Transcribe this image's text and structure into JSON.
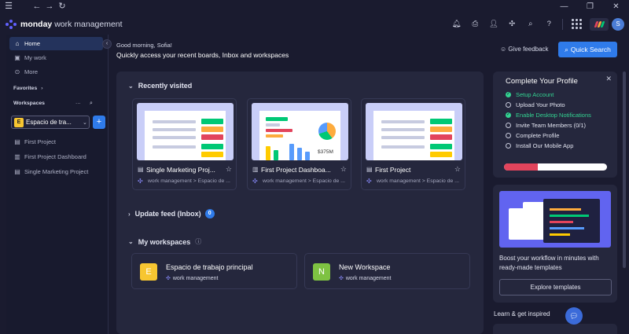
{
  "titlebar": {
    "menu_icon": "hamburger-icon",
    "back_icon": "arrow-left-icon",
    "forward_icon": "arrow-right-icon",
    "reload_icon": "reload-icon"
  },
  "brand": {
    "name": "monday",
    "suffix": "work management"
  },
  "sidebar": {
    "nav": [
      {
        "label": "Home",
        "icon": "home-icon"
      },
      {
        "label": "My work",
        "icon": "calendar-icon"
      },
      {
        "label": "More",
        "icon": "more-icon"
      }
    ],
    "favorites_label": "Favorites",
    "workspaces_label": "Workspaces",
    "workspace_selected": "Espacio de tra...",
    "workspace_initial": "E",
    "boards": [
      {
        "label": "First Project",
        "icon": "board-icon"
      },
      {
        "label": "First Project Dashboard",
        "icon": "dashboard-icon"
      },
      {
        "label": "Single Marketing Project",
        "icon": "board-icon"
      }
    ]
  },
  "header": {
    "greeting": "Good morning, Sofia!",
    "subtitle": "Quickly access your recent boards, Inbox and workspaces",
    "feedback_label": "Give feedback",
    "quick_search_label": "Quick Search",
    "avatar_initial": "S"
  },
  "recently_visited": {
    "title": "Recently visited",
    "cards": [
      {
        "title": "Single Marketing Proj...",
        "path": "work management > Espacio de ..."
      },
      {
        "title": "First Project Dashboa...",
        "path": "work management > Espacio de ...",
        "amount": "$375M"
      },
      {
        "title": "First Project",
        "path": "work management > Espacio de ..."
      }
    ]
  },
  "update_feed": {
    "title": "Update feed (Inbox)",
    "count": "0"
  },
  "my_workspaces": {
    "title": "My workspaces",
    "items": [
      {
        "initial": "E",
        "name": "Espacio de trabajo principal",
        "sub": "work management",
        "color": "#f7c631"
      },
      {
        "initial": "N",
        "name": "New Workspace",
        "sub": "work management",
        "color": "#7ec242"
      }
    ]
  },
  "profile": {
    "title": "Complete Your Profile",
    "tasks": [
      {
        "label": "Setup Account",
        "done": true
      },
      {
        "label": "Upload Your Photo",
        "done": false
      },
      {
        "label": "Enable Desktop Notifications",
        "done": true
      },
      {
        "label": "Invite Team Members (0/1)",
        "done": false
      },
      {
        "label": "Complete Profile",
        "done": false
      },
      {
        "label": "Install Our Mobile App",
        "done": false
      }
    ],
    "progress": 0.33
  },
  "templates": {
    "text": "Boost your workflow in minutes with ready-made templates",
    "button": "Explore templates"
  },
  "learn_label": "Learn & get inspired",
  "colors": {
    "accent": "#2f7bea",
    "success": "#33d391",
    "progress": "#e2445c"
  }
}
